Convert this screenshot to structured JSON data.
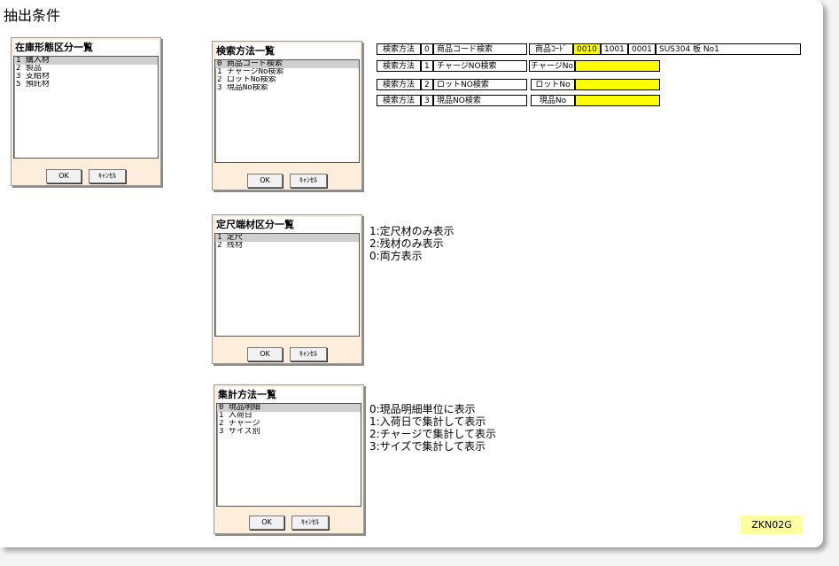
{
  "page": {
    "title": "抽出条件",
    "version_label": "ZKN02G"
  },
  "dialogs": {
    "zaiko": {
      "title": "在庫形態区分一覧",
      "items": [
        "1 購入材",
        "2 製品",
        "3 支給材",
        "5 預託材"
      ],
      "ok": "OK",
      "cancel": "ｷｬﾝｾﾙ"
    },
    "search": {
      "title": "検索方法一覧",
      "items": [
        "0 商品コード検索",
        "1 チャージNo検索",
        "2 ロットNo検索",
        "3 現品No検索"
      ],
      "ok": "OK",
      "cancel": "ｷｬﾝｾﾙ"
    },
    "teishaku": {
      "title": "定尺端材区分一覧",
      "items": [
        "1 定尺",
        "2 残材"
      ],
      "ok": "OK",
      "cancel": "ｷｬﾝｾﾙ"
    },
    "shukei": {
      "title": "集計方法一覧",
      "items": [
        "0 現品明細",
        "1 入荷日",
        "2 チャージ",
        "3 サイズ別"
      ],
      "ok": "OK",
      "cancel": "ｷｬﾝｾﾙ"
    }
  },
  "notes": {
    "teishaku": [
      "1:定尺材のみ表示",
      "2:残材のみ表示",
      "0:両方表示"
    ],
    "shukei": [
      "0:現品明細単位に表示",
      "1:入荷日で集計して表示",
      "2:チャージで集計して表示",
      "3:サイズで集計して表示"
    ]
  },
  "search_table": {
    "rows": [
      {
        "label": "検索方法",
        "code": "0",
        "method": "商品コード検索",
        "field_label": "商品ｺｰﾄﾞ",
        "values": [
          "0010",
          "1001",
          "0001",
          "SUS304 板 No1"
        ]
      },
      {
        "label": "検索方法",
        "code": "1",
        "method": "チャージNO検索",
        "field_label": "チャージNo",
        "values": [
          ""
        ]
      },
      {
        "label": "検索方法",
        "code": "2",
        "method": "ロットNO検索",
        "field_label": "ロットNo",
        "values": [
          ""
        ]
      },
      {
        "label": "検索方法",
        "code": "3",
        "method": "現品NO検索",
        "field_label": "現品No",
        "values": [
          ""
        ]
      }
    ],
    "highlight_color": "#ffff00"
  }
}
